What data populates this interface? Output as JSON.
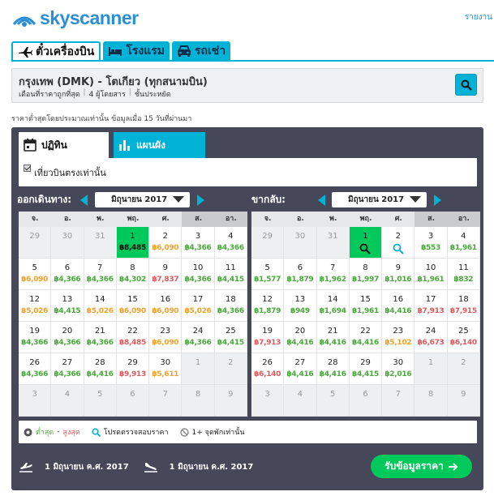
{
  "brand": {
    "name": "skyscanner",
    "top_right": "รายงาน"
  },
  "tabs": [
    {
      "label": "ตั๋วเครื่องบิน",
      "icon": "plane-icon"
    },
    {
      "label": "โรงแรม",
      "icon": "bed-icon"
    },
    {
      "label": "รถเช่า",
      "icon": "car-icon"
    }
  ],
  "search": {
    "route": "กรุงเทพ (DMK) - โตเกียว (ทุกสนามบิน)",
    "month": "เดือนที่ราคาถูกที่สุด",
    "travellers": "4 ผู้โดยสาร",
    "cabin": "ชั้นประหยัด"
  },
  "note": "ราคาต่ำสุดโดยประมาณเท่านั้น ข้อมูลเมื่อ 15 วันที่ผ่านมา",
  "view_tabs": {
    "calendar": "ปฏิทิน",
    "chart": "แผนผัง"
  },
  "direct_only": "เที่ยวบินตรงเท่านั้น",
  "weekdays": [
    "จ.",
    "อ.",
    "พ.",
    "พฤ.",
    "ศ.",
    "ส.",
    "อา."
  ],
  "depart": {
    "label": "ออกเดินทาง:",
    "month": "มิถุนายน 2017",
    "weeks": [
      [
        [
          "29",
          "",
          ""
        ],
        [
          "30",
          "",
          ""
        ],
        [
          "31",
          "",
          ""
        ],
        [
          "1",
          "฿8,485",
          "sel"
        ],
        [
          "2",
          "฿6,090",
          "o"
        ],
        [
          "3",
          "฿4,366",
          "g"
        ],
        [
          "4",
          "฿4,366",
          "g"
        ]
      ],
      [
        [
          "5",
          "฿6,090",
          "o"
        ],
        [
          "6",
          "฿4,366",
          "g"
        ],
        [
          "7",
          "฿4,366",
          "g"
        ],
        [
          "8",
          "฿4,302",
          "g"
        ],
        [
          "9",
          "฿7,837",
          "r"
        ],
        [
          "10",
          "฿4,366",
          "g"
        ],
        [
          "11",
          "฿4,415",
          "g"
        ]
      ],
      [
        [
          "12",
          "฿5,026",
          "o"
        ],
        [
          "13",
          "฿4,415",
          "g"
        ],
        [
          "14",
          "฿5,026",
          "o"
        ],
        [
          "15",
          "฿6,090",
          "o"
        ],
        [
          "16",
          "฿6,090",
          "o"
        ],
        [
          "17",
          "฿5,026",
          "o"
        ],
        [
          "18",
          "฿4,366",
          "g"
        ]
      ],
      [
        [
          "19",
          "฿4,366",
          "g"
        ],
        [
          "20",
          "฿4,366",
          "g"
        ],
        [
          "21",
          "฿4,366",
          "g"
        ],
        [
          "22",
          "฿8,485",
          "r"
        ],
        [
          "23",
          "฿6,090",
          "o"
        ],
        [
          "24",
          "฿4,366",
          "g"
        ],
        [
          "25",
          "฿4,415",
          "g"
        ]
      ],
      [
        [
          "26",
          "฿4,366",
          "g"
        ],
        [
          "27",
          "฿4,366",
          "g"
        ],
        [
          "28",
          "฿4,416",
          "g"
        ],
        [
          "29",
          "฿9,913",
          "r"
        ],
        [
          "30",
          "฿5,611",
          "o"
        ],
        [
          "1",
          "",
          ""
        ],
        [
          "2",
          "",
          ""
        ]
      ],
      [
        [
          "3",
          "",
          ""
        ],
        [
          "4",
          "",
          ""
        ],
        [
          "5",
          "",
          ""
        ],
        [
          "6",
          "",
          ""
        ],
        [
          "7",
          "",
          ""
        ],
        [
          "8",
          "",
          ""
        ],
        [
          "9",
          "",
          ""
        ]
      ]
    ]
  },
  "return": {
    "label": "ขากลับ:",
    "month": "มิถุนายน 2017",
    "weeks": [
      [
        [
          "29",
          "",
          ""
        ],
        [
          "30",
          "",
          ""
        ],
        [
          "31",
          "",
          ""
        ],
        [
          "1",
          "",
          "sel-mag"
        ],
        [
          "2",
          "",
          "mag"
        ],
        [
          "3",
          "฿553",
          "g"
        ],
        [
          "4",
          "฿1,961",
          "g"
        ]
      ],
      [
        [
          "5",
          "฿1,577",
          "g"
        ],
        [
          "6",
          "฿1,879",
          "g"
        ],
        [
          "7",
          "฿1,962",
          "g"
        ],
        [
          "8",
          "฿1,997",
          "g"
        ],
        [
          "9",
          "฿1,016",
          "g"
        ],
        [
          "10",
          "฿1,961",
          "g"
        ],
        [
          "11",
          "฿832",
          "g"
        ]
      ],
      [
        [
          "12",
          "฿1,879",
          "g"
        ],
        [
          "13",
          "฿949",
          "g"
        ],
        [
          "14",
          "฿1,694",
          "g"
        ],
        [
          "15",
          "฿1,961",
          "g"
        ],
        [
          "16",
          "฿4,416",
          "g"
        ],
        [
          "17",
          "฿7,913",
          "r"
        ],
        [
          "18",
          "฿7,915",
          "r"
        ]
      ],
      [
        [
          "19",
          "฿7,913",
          "r"
        ],
        [
          "20",
          "฿4,416",
          "g"
        ],
        [
          "21",
          "฿4,416",
          "g"
        ],
        [
          "22",
          "฿4,416",
          "g"
        ],
        [
          "23",
          "฿5,102",
          "o"
        ],
        [
          "24",
          "฿6,673",
          "r"
        ],
        [
          "25",
          "฿6,140",
          "r"
        ]
      ],
      [
        [
          "26",
          "฿6,140",
          "r"
        ],
        [
          "27",
          "฿4,416",
          "g"
        ],
        [
          "28",
          "฿4,416",
          "g"
        ],
        [
          "29",
          "฿4,415",
          "g"
        ],
        [
          "30",
          "฿2,016",
          "g"
        ],
        [
          "1",
          "",
          ""
        ],
        [
          "2",
          "",
          ""
        ]
      ],
      [
        [
          "3",
          "",
          ""
        ],
        [
          "4",
          "",
          ""
        ],
        [
          "5",
          "",
          ""
        ],
        [
          "6",
          "",
          ""
        ],
        [
          "7",
          "",
          ""
        ],
        [
          "8",
          "",
          ""
        ],
        [
          "9",
          "",
          ""
        ]
      ]
    ]
  },
  "legend": {
    "low": "ต่ำสุด",
    "dash": " - ",
    "high": "สูงสุด",
    "search_price": "โปรดตรวจสอบราคา",
    "stops": "1+ จุดพักเท่านั้น"
  },
  "footer": {
    "depart_date": "1 มิถุนายน ค.ศ. 2017",
    "return_date": "1 มิถุนายน ค.ศ. 2017",
    "cta": "รับข้อมูลราคา"
  },
  "colors": {
    "accent": "#00b2d6",
    "green": "#00c95b",
    "panel": "#47475a"
  }
}
